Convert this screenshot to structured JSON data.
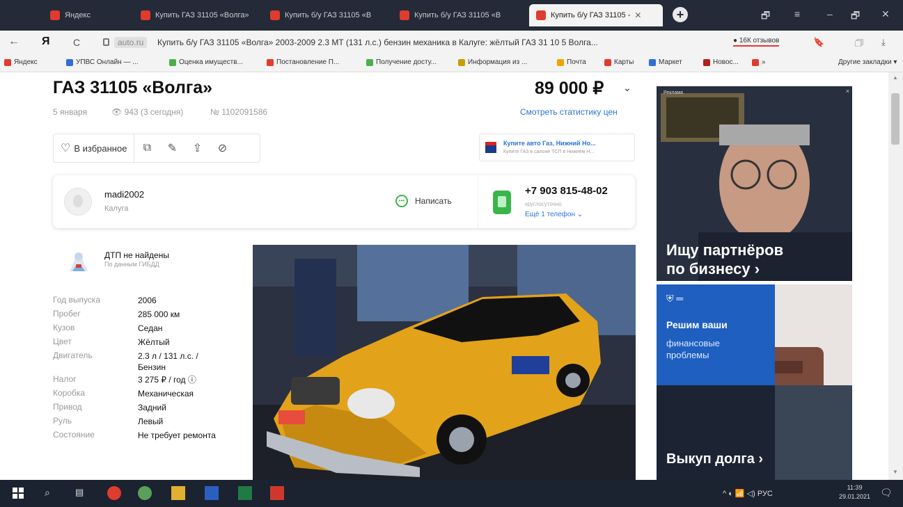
{
  "browser": {
    "tabs": [
      {
        "label": "Яндекс",
        "favicon_color": "#e03b2f",
        "active": false
      },
      {
        "label": "Купить ГАЗ 31105 «Волга»",
        "favicon_color": "#e03b2f",
        "active": false
      },
      {
        "label": "Купить б/у ГАЗ 31105 «В",
        "favicon_color": "#e03b2f",
        "active": false
      },
      {
        "label": "Купить б/у ГАЗ 31105 «В",
        "favicon_color": "#e03b2f",
        "active": false
      },
      {
        "label": "Купить б/у ГАЗ 31105 -",
        "favicon_color": "#e03b2f",
        "active": true
      }
    ],
    "new_tab_label": "+",
    "window_controls": [
      "🗗",
      "≡",
      "–",
      "🗗",
      "✕"
    ],
    "address": {
      "back": "←",
      "yandex": "Я",
      "reload": "C",
      "domain": "auto.ru",
      "page_title": "Купить б/у ГАЗ 31105 «Волга» 2003-2009 2.3 MT (131 л.с.) бензин механика в Калуге: жёлтый ГАЗ 31 10 5 Волга...",
      "reviews": "● 16К отзывов",
      "bookmark_icon": "🔖",
      "extensions_icon": "🗇",
      "download_icon": "⤓"
    },
    "bookmarks": [
      {
        "label": "Яндекс",
        "color": "#e03b2f"
      },
      {
        "label": "УПВС Онлайн — ...",
        "color": "#2f6fd6"
      },
      {
        "label": "Оценка имуществ...",
        "color": "#4cae4c"
      },
      {
        "label": "Постановление П...",
        "color": "#e03b2f"
      },
      {
        "label": "Получение досту...",
        "color": "#4cae4c"
      },
      {
        "label": "Информация из ...",
        "color": "#c6a000"
      },
      {
        "label": "Почта",
        "color": "#f0a500"
      },
      {
        "label": "Карты",
        "color": "#e03b2f"
      },
      {
        "label": "Маркет",
        "color": "#2f6fd6"
      },
      {
        "label": "Новос...",
        "color": "#b02020"
      },
      {
        "label": "»",
        "color": "#e03b2f"
      },
      {
        "label": "Другие закладки ▾",
        "color": "transparent"
      }
    ]
  },
  "listing": {
    "title": "ГАЗ 31105 «Волга»",
    "price": "89 000 ₽",
    "price_chevron": "⌄",
    "date": "5 января",
    "views": "👁 943 (3 сегодня)",
    "number": "№ 1102091586",
    "price_stats_link": "Смотреть статистику цен",
    "actions": {
      "favorite_icon": "♡",
      "favorite_label": "В избранное",
      "compare_icon": "⧉",
      "note_icon": "✎",
      "share_icon": "⇪",
      "block_icon": "⊘"
    },
    "small_ad": {
      "title": "Купите авто Газ, Нижний Но...",
      "subtitle": "Купите ГАЗ в салоне ТСП в Нижнем Н..."
    },
    "seller": {
      "username": "madi2002",
      "city": "Калуга",
      "message_label": "Написать",
      "phone": "+7 903 815-48-02",
      "phone_note": "круглосуточно",
      "more_phones": "Ещё 1 телефон ⌄"
    },
    "dtp": {
      "title": "ДТП не найдены",
      "subtitle": "По данным ГИБДД"
    },
    "specs": [
      {
        "key": "Год выпуска",
        "value": "2006"
      },
      {
        "key": "Пробег",
        "value": "285 000 км"
      },
      {
        "key": "Кузов",
        "value": "Седан"
      },
      {
        "key": "Цвет",
        "value": "Жёлтый"
      },
      {
        "key": "Двигатель",
        "value": "2.3 л / 131 л.с. / Бензин"
      },
      {
        "key": "Налог",
        "value": "3 275 ₽ / год ⓘ"
      },
      {
        "key": "Коробка",
        "value": "Механическая"
      },
      {
        "key": "Привод",
        "value": "Задний"
      },
      {
        "key": "Руль",
        "value": "Левый"
      },
      {
        "key": "Состояние",
        "value": "Не требует ремонта"
      }
    ]
  },
  "ads": {
    "banner1": {
      "label": "Реклама",
      "text_line1": "Ищу партнёров",
      "text_line2": "по бизнесу ›",
      "close": "×"
    },
    "banner2": {
      "line1": "Решим ваши",
      "line2": "финансовые",
      "line3": "проблемы",
      "cta": "Выкуп долга ›"
    }
  },
  "taskbar": {
    "tray_text": "^ ◐ 📶 ◁) РУС",
    "time": "11:39",
    "date": "29.01.2021"
  },
  "colors": {
    "accent_link": "#2b73d6",
    "green": "#3ab54a",
    "taxi_yellow": "#e2a21a"
  }
}
